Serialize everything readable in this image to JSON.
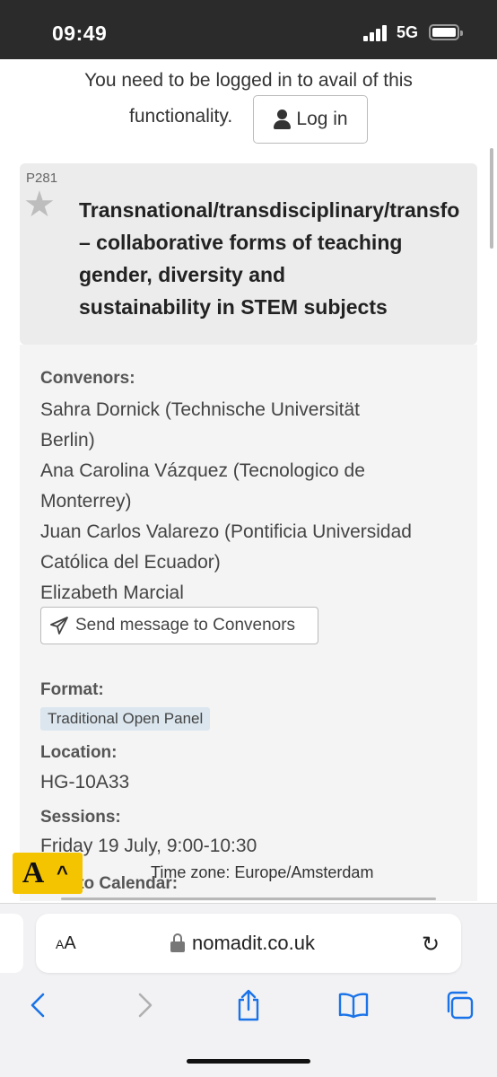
{
  "status_bar": {
    "time": "09:49",
    "network": "5G"
  },
  "login": {
    "message_line1": "You need to be logged in to avail of this",
    "message_line2": "functionality.",
    "button_label": "Log in"
  },
  "panel": {
    "code": "P281",
    "title": "Transnational/transdisciplinary/transfo\n– collaborative forms of teaching\ngender, diversity and\nsustainability in STEM subjects",
    "convenors_label": "Convenors:",
    "convenors": [
      "Sahra Dornick (Technische Universität",
      "Berlin)",
      "Ana Carolina Vázquez (Tecnologico de",
      "Monterrey)",
      "Juan Carlos Valarezo (Pontificia Universidad",
      "Católica del Ecuador)",
      "Elizabeth Marcial"
    ],
    "send_message_label": "Send message to Convenors",
    "format_label": "Format:",
    "format_value": "Traditional Open Panel",
    "location_label": "Location:",
    "location_value": "HG-10A33",
    "sessions_label": "Sessions:",
    "session_value": "Friday 19 July, 9:00-10:30",
    "timezone": "Time zone: Europe/Amsterdam",
    "add_calendar_label": "Add to Calendar:"
  },
  "browser": {
    "aa_label": "AA",
    "domain": "nomadit.co.uk"
  },
  "colors": {
    "badge_bg": "#dbe6ee",
    "a11y_bg": "#f5c400",
    "ios_blue": "#1a73e8"
  }
}
